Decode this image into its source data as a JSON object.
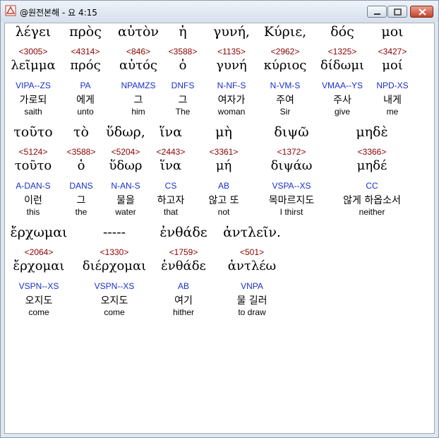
{
  "window": {
    "title": "@원전본해 - 요 4:15"
  },
  "words": [
    {
      "greek": "λέγει",
      "strong": "<3005>",
      "lemma": "λεῖμμα",
      "parse": "VIPA--ZS",
      "korean": "가로되",
      "english": "saith"
    },
    {
      "greek": "πρὸς",
      "strong": "<4314>",
      "lemma": "πρός",
      "parse": "PA",
      "korean": "에게",
      "english": "unto"
    },
    {
      "greek": "αὐτὸν",
      "strong": "<846>",
      "lemma": "αὐτός",
      "parse": "NPAMZS",
      "korean": "그",
      "english": "him"
    },
    {
      "greek": "ἡ",
      "strong": "<3588>",
      "lemma": "ὁ",
      "parse": "DNFS",
      "korean": "그",
      "english": "The"
    },
    {
      "greek": "γυνή,",
      "strong": "<1135>",
      "lemma": "γυνή",
      "parse": "N-NF-S",
      "korean": "여자가",
      "english": "woman"
    },
    {
      "greek": "Κύριε,",
      "strong": "<2962>",
      "lemma": "κύριος",
      "parse": "N-VM-S",
      "korean": "주여",
      "english": "Sir"
    },
    {
      "greek": "δός",
      "strong": "<1325>",
      "lemma": "δίδωμι",
      "parse": "VMAA--YS",
      "korean": "주사",
      "english": "give"
    },
    {
      "greek": "μοι",
      "strong": "<3427>",
      "lemma": "μοί",
      "parse": "NPD-XS",
      "korean": "내게",
      "english": "me"
    },
    {
      "greek": "τοῦτο",
      "strong": "<5124>",
      "lemma": "τοῦτο",
      "parse": "A-DAN-S",
      "korean": "이런",
      "english": "this"
    },
    {
      "greek": "τὸ",
      "strong": "<3588>",
      "lemma": "ὁ",
      "parse": "DANS",
      "korean": "그",
      "english": "the"
    },
    {
      "greek": "ὕδωρ,",
      "strong": "<5204>",
      "lemma": "ὕδωρ",
      "parse": "N-AN-S",
      "korean": "물을",
      "english": "water"
    },
    {
      "greek": "ἵνα",
      "strong": "<2443>",
      "lemma": "ἵνα",
      "parse": "CS",
      "korean": "하고자",
      "english": "that"
    },
    {
      "greek": "μὴ",
      "strong": "<3361>",
      "lemma": "μή",
      "parse": "AB",
      "korean": "않고 또",
      "english": "not"
    },
    {
      "greek": "διψῶ",
      "strong": "<1372>",
      "lemma": "διψάω",
      "parse": "VSPA--XS",
      "korean": "목마르지도",
      "english": "I thirst"
    },
    {
      "greek": "μηδὲ",
      "strong": "<3366>",
      "lemma": "μηδέ",
      "parse": "CC",
      "korean": "않게 하옵소서",
      "english": "neither"
    },
    {
      "greek": "ἔρχωμαι",
      "strong": "<2064>",
      "lemma": "ἔρχομαι",
      "parse": "VSPN--XS",
      "korean": "오지도",
      "english": "come"
    },
    {
      "greek": "-----",
      "strong": "<1330>",
      "lemma": "διέρχομαι",
      "parse": "VSPN--XS",
      "korean": "오지도",
      "english": "come"
    },
    {
      "greek": "ἐνθάδε",
      "strong": "<1759>",
      "lemma": "ἐνθάδε",
      "parse": "AB",
      "korean": "여기",
      "english": "hither"
    },
    {
      "greek": "ἀντλεῖν.",
      "strong": "<501>",
      "lemma": "ἀντλέω",
      "parse": "VNPA",
      "korean": "물 길러",
      "english": "to draw"
    }
  ]
}
